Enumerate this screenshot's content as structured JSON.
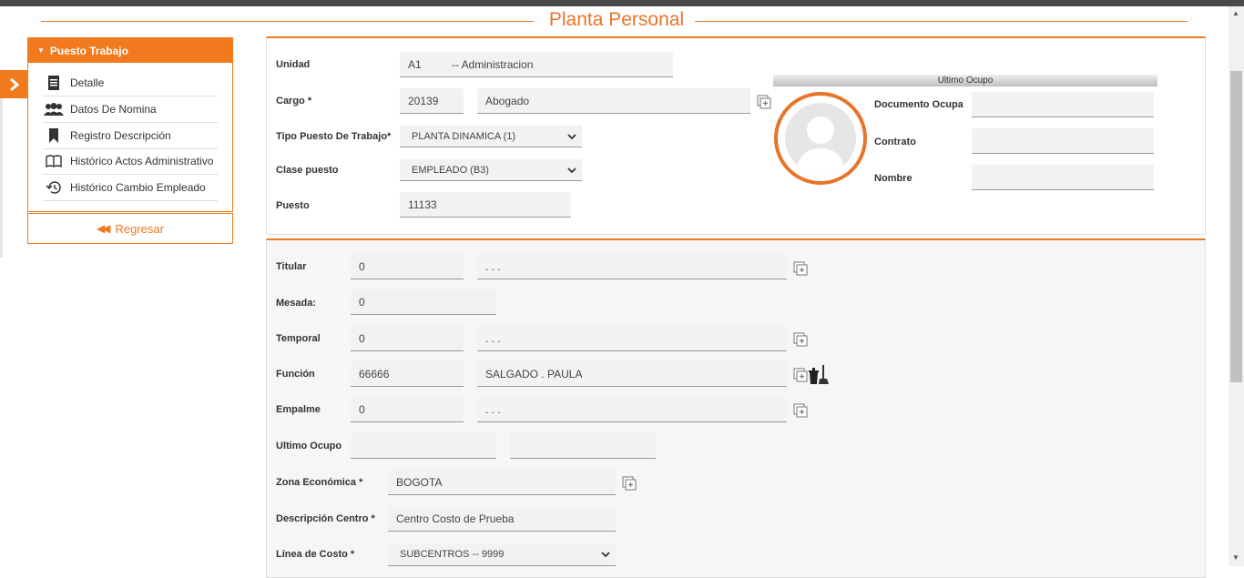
{
  "page": {
    "title": "Planta Personal"
  },
  "sidebar": {
    "header": "Puesto Trabajo",
    "items": [
      {
        "label": "Detalle",
        "icon": "document-icon"
      },
      {
        "label": "Datos De Nomina",
        "icon": "users-icon"
      },
      {
        "label": "Registro Descripción",
        "icon": "bookmark-icon"
      },
      {
        "label": "Histórico Actos Administrativo",
        "icon": "book-icon"
      },
      {
        "label": "Histórico Cambio Empleado",
        "icon": "history-icon"
      }
    ],
    "back_label": "Regresar"
  },
  "form": {
    "unidad": {
      "label": "Unidad",
      "value": "A1          -- Administracion"
    },
    "cargo": {
      "label": "Cargo *",
      "code": "20139",
      "name": "Abogado"
    },
    "tipo_puesto": {
      "label": "Tipo Puesto De Trabajo*",
      "value": "PLANTA DINAMICA (1)"
    },
    "clase_puesto": {
      "label": "Clase puesto",
      "value": "EMPLEADO (B3)"
    },
    "puesto": {
      "label": "Puesto",
      "value": "11133"
    }
  },
  "ultimo_ocupo": {
    "header": "Ultimo Ocupo",
    "documento_label": "Documento Ocupa",
    "documento_value": "",
    "contrato_label": "Contrato",
    "contrato_value": "",
    "nombre_label": "Nombre",
    "nombre_value": ""
  },
  "details": {
    "titular": {
      "label": "Titular",
      "code": "0",
      "name": ". . ."
    },
    "mesada": {
      "label": "Mesada:",
      "value": "0"
    },
    "temporal": {
      "label": "Temporal",
      "code": "0",
      "name": ". . ."
    },
    "funcion": {
      "label": "Función",
      "code": "66666",
      "name": "SALGADO . PAULA"
    },
    "empalme": {
      "label": "Empalme",
      "code": "0",
      "name": ". . ."
    },
    "ultimo_ocupo": {
      "label": "Ultimo Ocupo",
      "code": "",
      "name": ""
    },
    "zona": {
      "label": "Zona Económica *",
      "value": "BOGOTA"
    },
    "descripcion_centro": {
      "label": "Descripción Centro *",
      "value": "Centro Costo de Prueba"
    },
    "linea_costo": {
      "label": "Línea de Costo *",
      "value": "SUBCENTROS -- 9999"
    }
  },
  "colors": {
    "accent": "#f07a1d",
    "topbar": "#4a4a4a"
  }
}
